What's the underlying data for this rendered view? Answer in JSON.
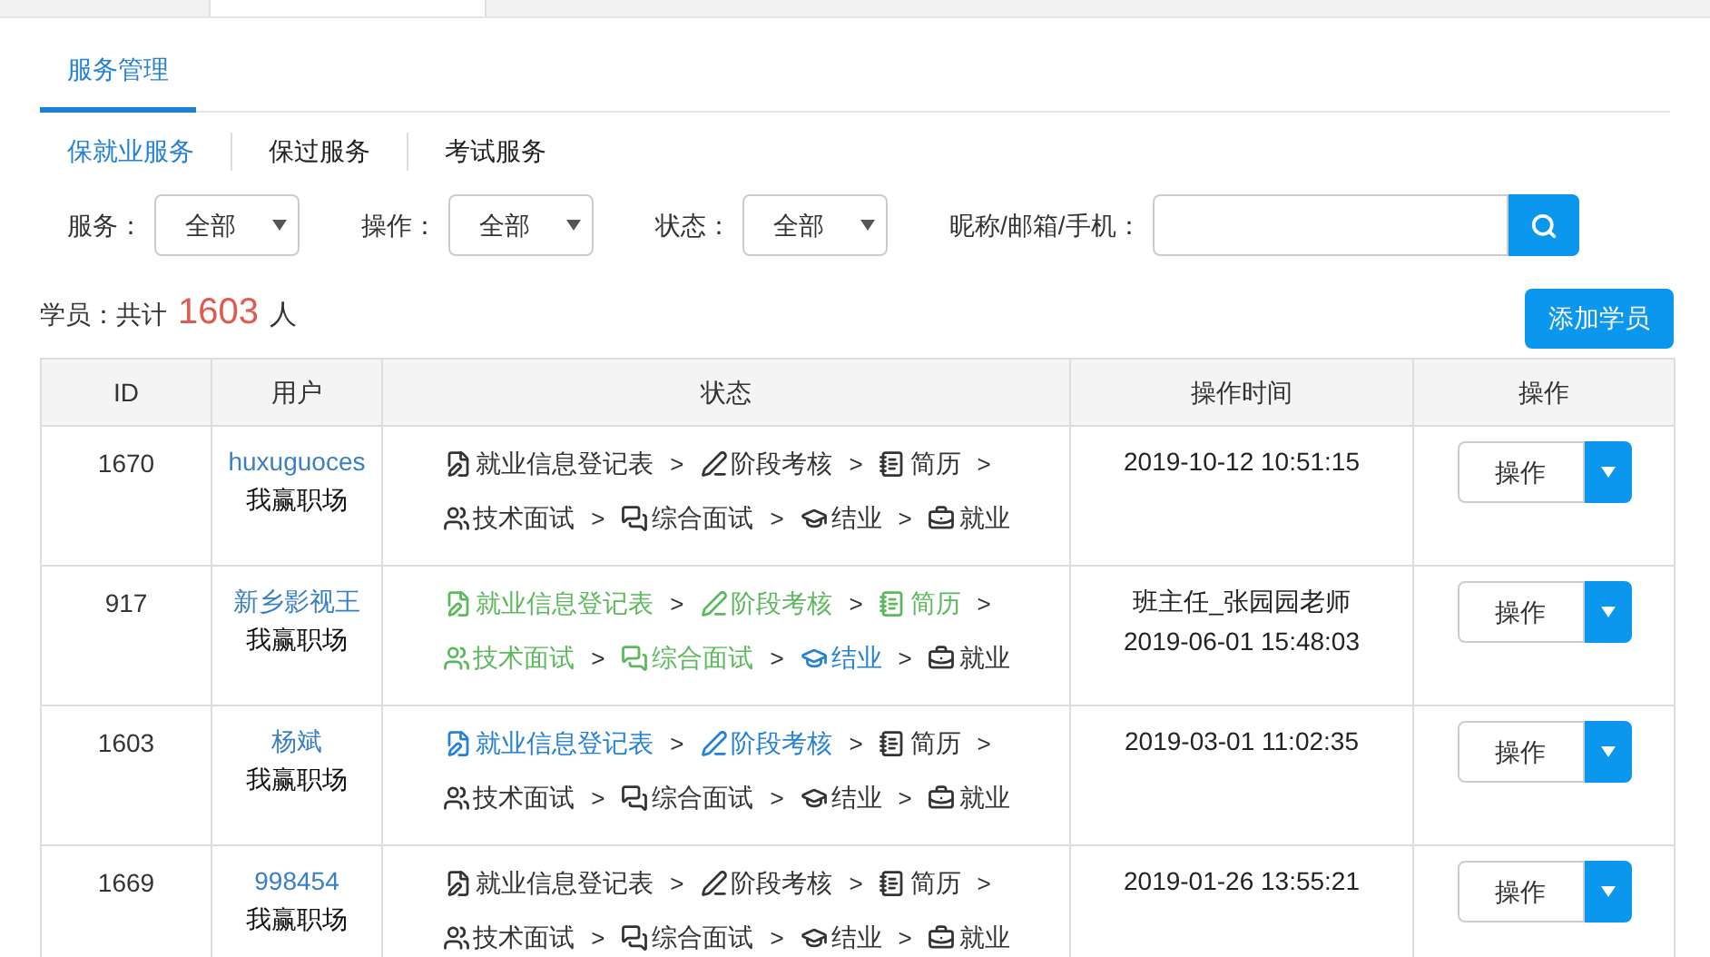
{
  "page_tabs": [
    {
      "label": "服务管理",
      "selected": true
    }
  ],
  "service_tabs": [
    {
      "label": "保就业服务",
      "selected": true
    },
    {
      "label": "保过服务",
      "selected": false
    },
    {
      "label": "考试服务",
      "selected": false
    }
  ],
  "filters": [
    {
      "label": "服务：",
      "value": "全部"
    },
    {
      "label": "操作：",
      "value": "全部"
    },
    {
      "label": "状态：",
      "value": "全部"
    }
  ],
  "search": {
    "label": "昵称/邮箱/手机："
  },
  "summary": {
    "prefix": "学员：共计",
    "count": "1603",
    "suffix": "人"
  },
  "add_button": "添加学员",
  "table": {
    "columns": [
      "ID",
      "用户",
      "状态",
      "操作时间",
      "操作"
    ],
    "rows": [
      {
        "id": "1670",
        "user": "huxuguoces",
        "org": "我赢职场",
        "status_lines": [
          [
            {
              "kind": "form",
              "label": "就业信息登记表",
              "color": "#333333",
              "separator": ">"
            },
            {
              "kind": "pen",
              "label": "阶段考核",
              "color": "#333333",
              "separator": ">"
            },
            {
              "kind": "notebook",
              "label": "简历",
              "color": "#333333",
              "separator": ">"
            }
          ],
          [
            {
              "kind": "users",
              "label": "技术面试",
              "color": "#333333",
              "separator": ">"
            },
            {
              "kind": "chat",
              "label": "综合面试",
              "color": "#333333",
              "separator": ">"
            },
            {
              "kind": "cap",
              "label": "结业",
              "color": "#333333",
              "separator": ">"
            },
            {
              "kind": "briefcase",
              "label": "就业",
              "color": "#333333"
            }
          ]
        ],
        "time_lines": [
          "2019-10-12 10:51:15"
        ],
        "action": "操作"
      },
      {
        "id": "917",
        "user": "新乡影视王",
        "org": "我赢职场",
        "status_lines": [
          [
            {
              "kind": "form",
              "label": "就业信息登记表",
              "color": "#5cb85c",
              "separator": ">"
            },
            {
              "kind": "pen",
              "label": "阶段考核",
              "color": "#5cb85c",
              "separator": ">"
            },
            {
              "kind": "notebook",
              "label": "简历",
              "color": "#5cb85c",
              "separator": ">"
            }
          ],
          [
            {
              "kind": "users",
              "label": "技术面试",
              "color": "#5cb85c",
              "separator": ">"
            },
            {
              "kind": "chat",
              "label": "综合面试",
              "color": "#5cb85c",
              "separator": ">"
            },
            {
              "kind": "cap",
              "label": "结业",
              "color": "#2481d6",
              "separator": ">"
            },
            {
              "kind": "briefcase",
              "label": "就业",
              "color": "#333333"
            }
          ]
        ],
        "time_lines": [
          "班主任_张园园老师",
          "2019-06-01 15:48:03"
        ],
        "action": "操作"
      },
      {
        "id": "1603",
        "user": "杨斌",
        "org": "我赢职场",
        "status_lines": [
          [
            {
              "kind": "form",
              "label": "就业信息登记表",
              "color": "#2481d6",
              "separator": ">"
            },
            {
              "kind": "pen",
              "label": "阶段考核",
              "color": "#2481d6",
              "separator": ">"
            },
            {
              "kind": "notebook",
              "label": "简历",
              "color": "#333333",
              "separator": ">"
            }
          ],
          [
            {
              "kind": "users",
              "label": "技术面试",
              "color": "#333333",
              "separator": ">"
            },
            {
              "kind": "chat",
              "label": "综合面试",
              "color": "#333333",
              "separator": ">"
            },
            {
              "kind": "cap",
              "label": "结业",
              "color": "#333333",
              "separator": ">"
            },
            {
              "kind": "briefcase",
              "label": "就业",
              "color": "#333333"
            }
          ]
        ],
        "time_lines": [
          "2019-03-01 11:02:35"
        ],
        "action": "操作"
      },
      {
        "id": "1669",
        "user": "998454",
        "org": "我赢职场",
        "status_lines": [
          [
            {
              "kind": "form",
              "label": "就业信息登记表",
              "color": "#333333",
              "separator": ">"
            },
            {
              "kind": "pen",
              "label": "阶段考核",
              "color": "#333333",
              "separator": ">"
            },
            {
              "kind": "notebook",
              "label": "简历",
              "color": "#333333",
              "separator": ">"
            }
          ],
          [
            {
              "kind": "users",
              "label": "技术面试",
              "color": "#333333",
              "separator": ">"
            },
            {
              "kind": "chat",
              "label": "综合面试",
              "color": "#333333",
              "separator": ">"
            },
            {
              "kind": "cap",
              "label": "结业",
              "color": "#333333",
              "separator": ">"
            },
            {
              "kind": "briefcase",
              "label": "就业",
              "color": "#333333"
            }
          ]
        ],
        "time_lines": [
          "2019-01-26 13:55:21"
        ],
        "action": "操作"
      }
    ]
  }
}
